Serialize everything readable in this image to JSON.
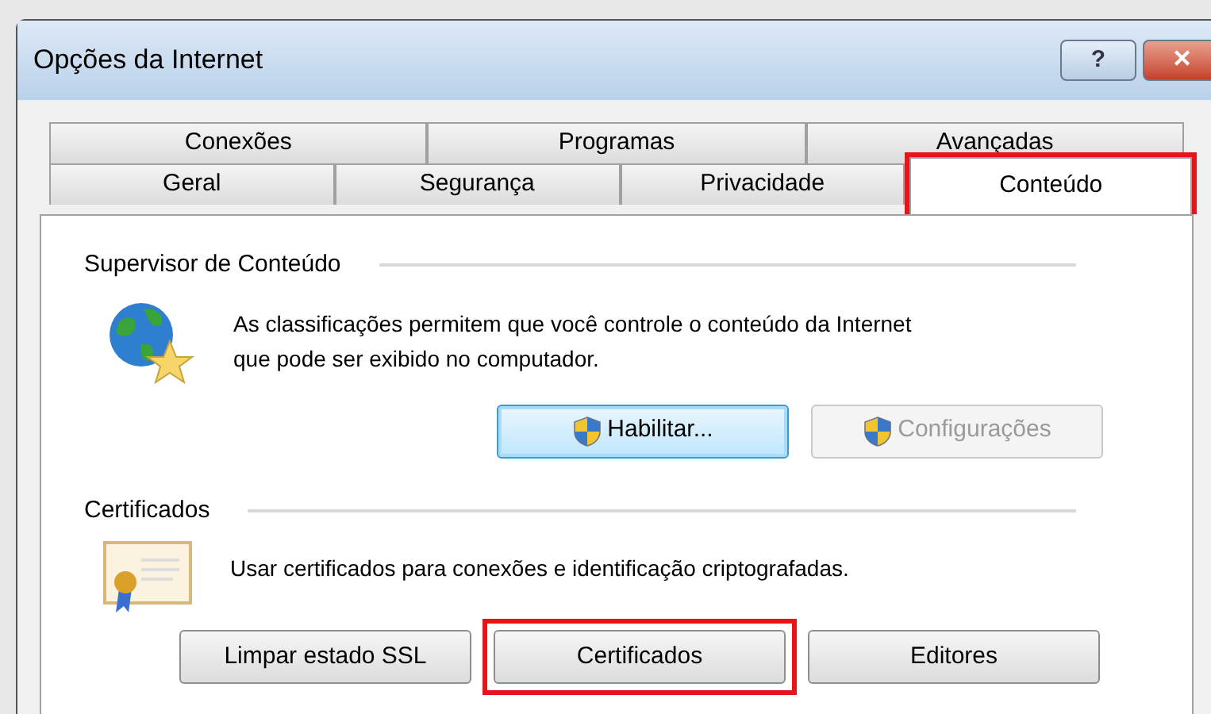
{
  "window": {
    "title": "Opções da Internet",
    "controls": [
      "?",
      "✕"
    ]
  },
  "tab_rows": [
    [
      {
        "label": "Conexões",
        "selected": false,
        "highlighted": false
      },
      {
        "label": "Programas",
        "selected": false,
        "highlighted": false
      },
      {
        "label": "Avançadas",
        "selected": false,
        "highlighted": false
      }
    ],
    [
      {
        "label": "Geral",
        "selected": false,
        "highlighted": false
      },
      {
        "label": "Segurança",
        "selected": false,
        "highlighted": false
      },
      {
        "label": "Privacidade",
        "selected": false,
        "highlighted": false
      },
      {
        "label": "Conteúdo",
        "selected": true,
        "highlighted": true
      }
    ]
  ],
  "groups": [
    {
      "title": "Supervisor de Conteúdo",
      "kind": "globe",
      "text": "As classificações permitem que você controle o conteúdo da Internet que pode ser exibido no computador.",
      "buttons": [
        {
          "label": "Habilitar...",
          "shield": true,
          "disabled": false,
          "focused": true,
          "highlighted": false
        },
        {
          "label": "Configurações",
          "shield": true,
          "disabled": true,
          "focused": false,
          "highlighted": false
        }
      ]
    },
    {
      "title": "Certificados",
      "kind": "certificate",
      "text": "Usar certificados para conexões e identificação criptografadas.",
      "buttons": [
        {
          "label": "Limpar estado SSL",
          "shield": false,
          "disabled": false,
          "focused": false,
          "highlighted": false
        },
        {
          "label": "Certificados",
          "shield": false,
          "disabled": false,
          "focused": false,
          "highlighted": true
        },
        {
          "label": "Editores",
          "shield": false,
          "disabled": false,
          "focused": false,
          "highlighted": false
        }
      ]
    }
  ]
}
